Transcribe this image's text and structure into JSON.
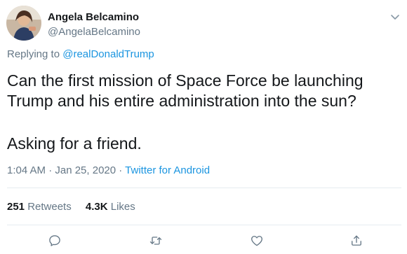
{
  "user": {
    "display_name": "Angela Belcamino",
    "handle": "@AngelaBelcamino"
  },
  "reply": {
    "prefix": "Replying to ",
    "mention": "@realDonaldTrump"
  },
  "tweet": {
    "line1": "Can the first mission of Space Force be launching",
    "line2": "Trump and his entire administration into the sun?",
    "line3": "Asking for a friend."
  },
  "meta": {
    "time_date": "1:04 AM · Jan 25, 2020 · ",
    "source": "Twitter for Android"
  },
  "stats": {
    "retweets_count": "251",
    "retweets_label": " Retweets",
    "likes_count": "4.3K",
    "likes_label": " Likes"
  },
  "icons": {
    "reply": "comment-icon",
    "retweet": "retweet-icon",
    "like": "heart-icon",
    "share": "share-icon",
    "more": "chevron-down-icon"
  },
  "colors": {
    "link": "#1b95e0",
    "secondary_text": "#657786",
    "primary_text": "#14171a",
    "divider": "#e6ecf0"
  }
}
